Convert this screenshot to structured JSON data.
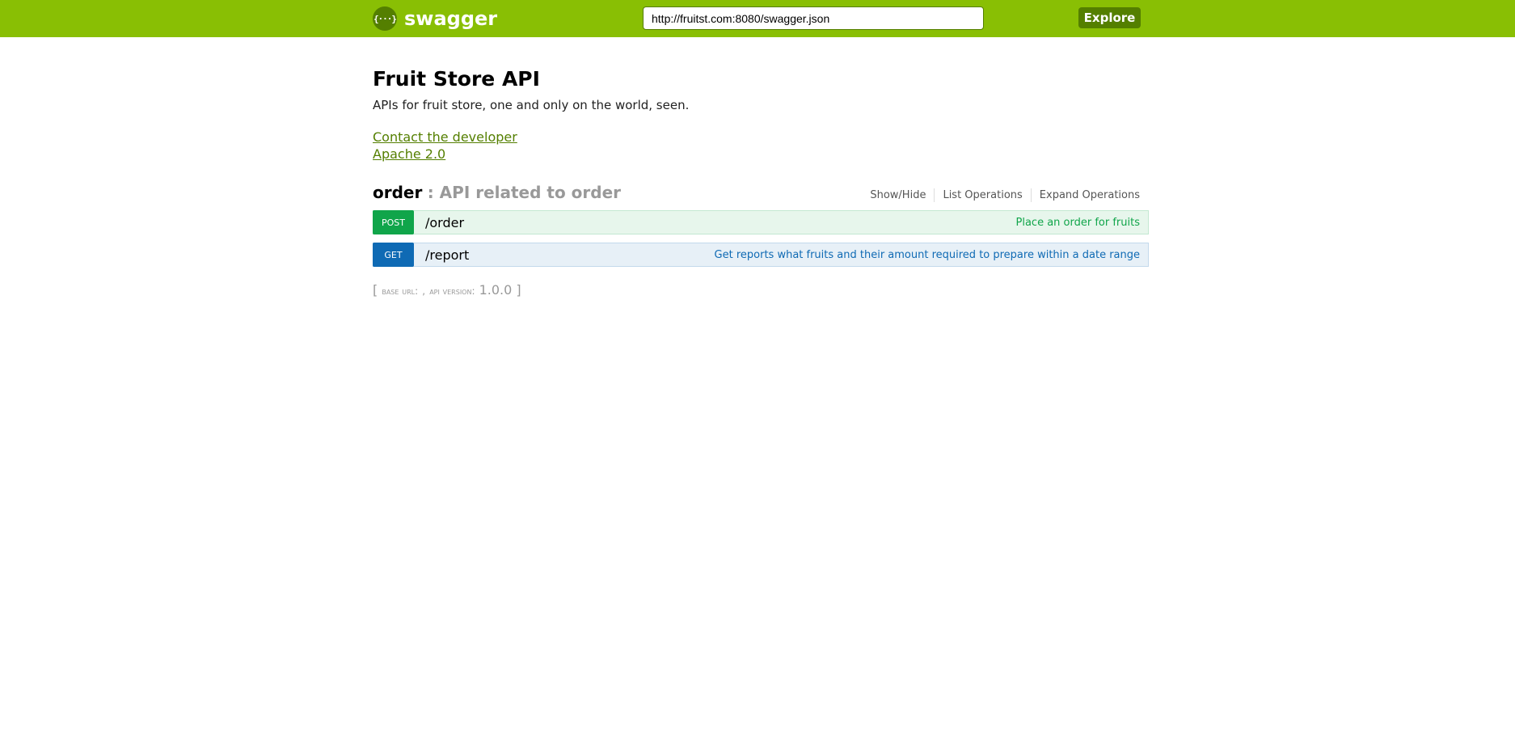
{
  "header": {
    "logo_glyph": "{···}",
    "logo_text": "swagger",
    "url_value": "http://fruitst.com:8080/swagger.json",
    "explore_label": "Explore",
    "colors": {
      "bar": "#89bf04",
      "dark": "#547f00"
    }
  },
  "info": {
    "title": "Fruit Store API",
    "description": "APIs for fruit store, one and only on the world, seen.",
    "contact_label": "Contact the developer",
    "license_label": "Apache 2.0"
  },
  "resource": {
    "name": "order",
    "description": ": API related to order",
    "options": {
      "show_hide": "Show/Hide",
      "list_operations": "List Operations",
      "expand_operations": "Expand Operations"
    },
    "operations": [
      {
        "method": "POST",
        "path": "/order",
        "summary": "Place an order for fruits",
        "color": "#10a54a"
      },
      {
        "method": "GET",
        "path": "/report",
        "summary": "Get reports what fruits and their amount required to prepare within a date range",
        "color": "#0f6ab4"
      }
    ]
  },
  "footer": {
    "open_bracket": "[",
    "base_url_label": "BASE URL",
    "base_url_value": ":",
    "separator": ",",
    "api_version_label": "API VERSION",
    "api_version_colon": ":",
    "api_version_value": "1.0.0",
    "close_bracket": "]"
  }
}
